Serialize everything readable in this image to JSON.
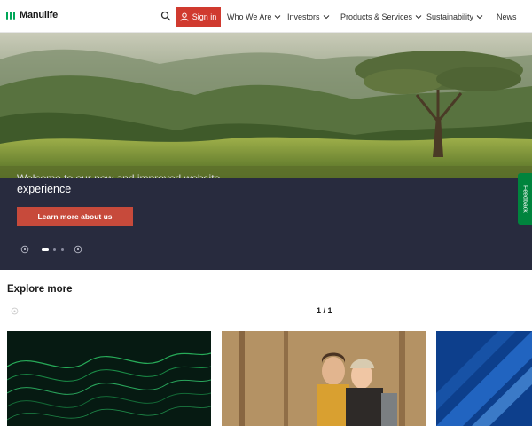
{
  "header": {
    "logo_text": "Manulife",
    "signin_label": "Sign in",
    "nav": [
      {
        "label": "Who We Are"
      },
      {
        "label": "Investors"
      },
      {
        "label": "Products & Services"
      },
      {
        "label": "Sustainability"
      },
      {
        "label": "News"
      }
    ]
  },
  "hero": {
    "overflow_text": "Welcome to our new and improved website",
    "text": "experience",
    "cta_label": "Learn more about us",
    "slides": 3,
    "active_slide": 1
  },
  "feedback_label": "Feedback",
  "explore": {
    "title": "Explore more",
    "pager": "1 / 1"
  },
  "colors": {
    "brand_green": "#00a758",
    "signin_red": "#d03a2f",
    "hero_bg": "#282b3e",
    "cta": "#c74a3b"
  }
}
